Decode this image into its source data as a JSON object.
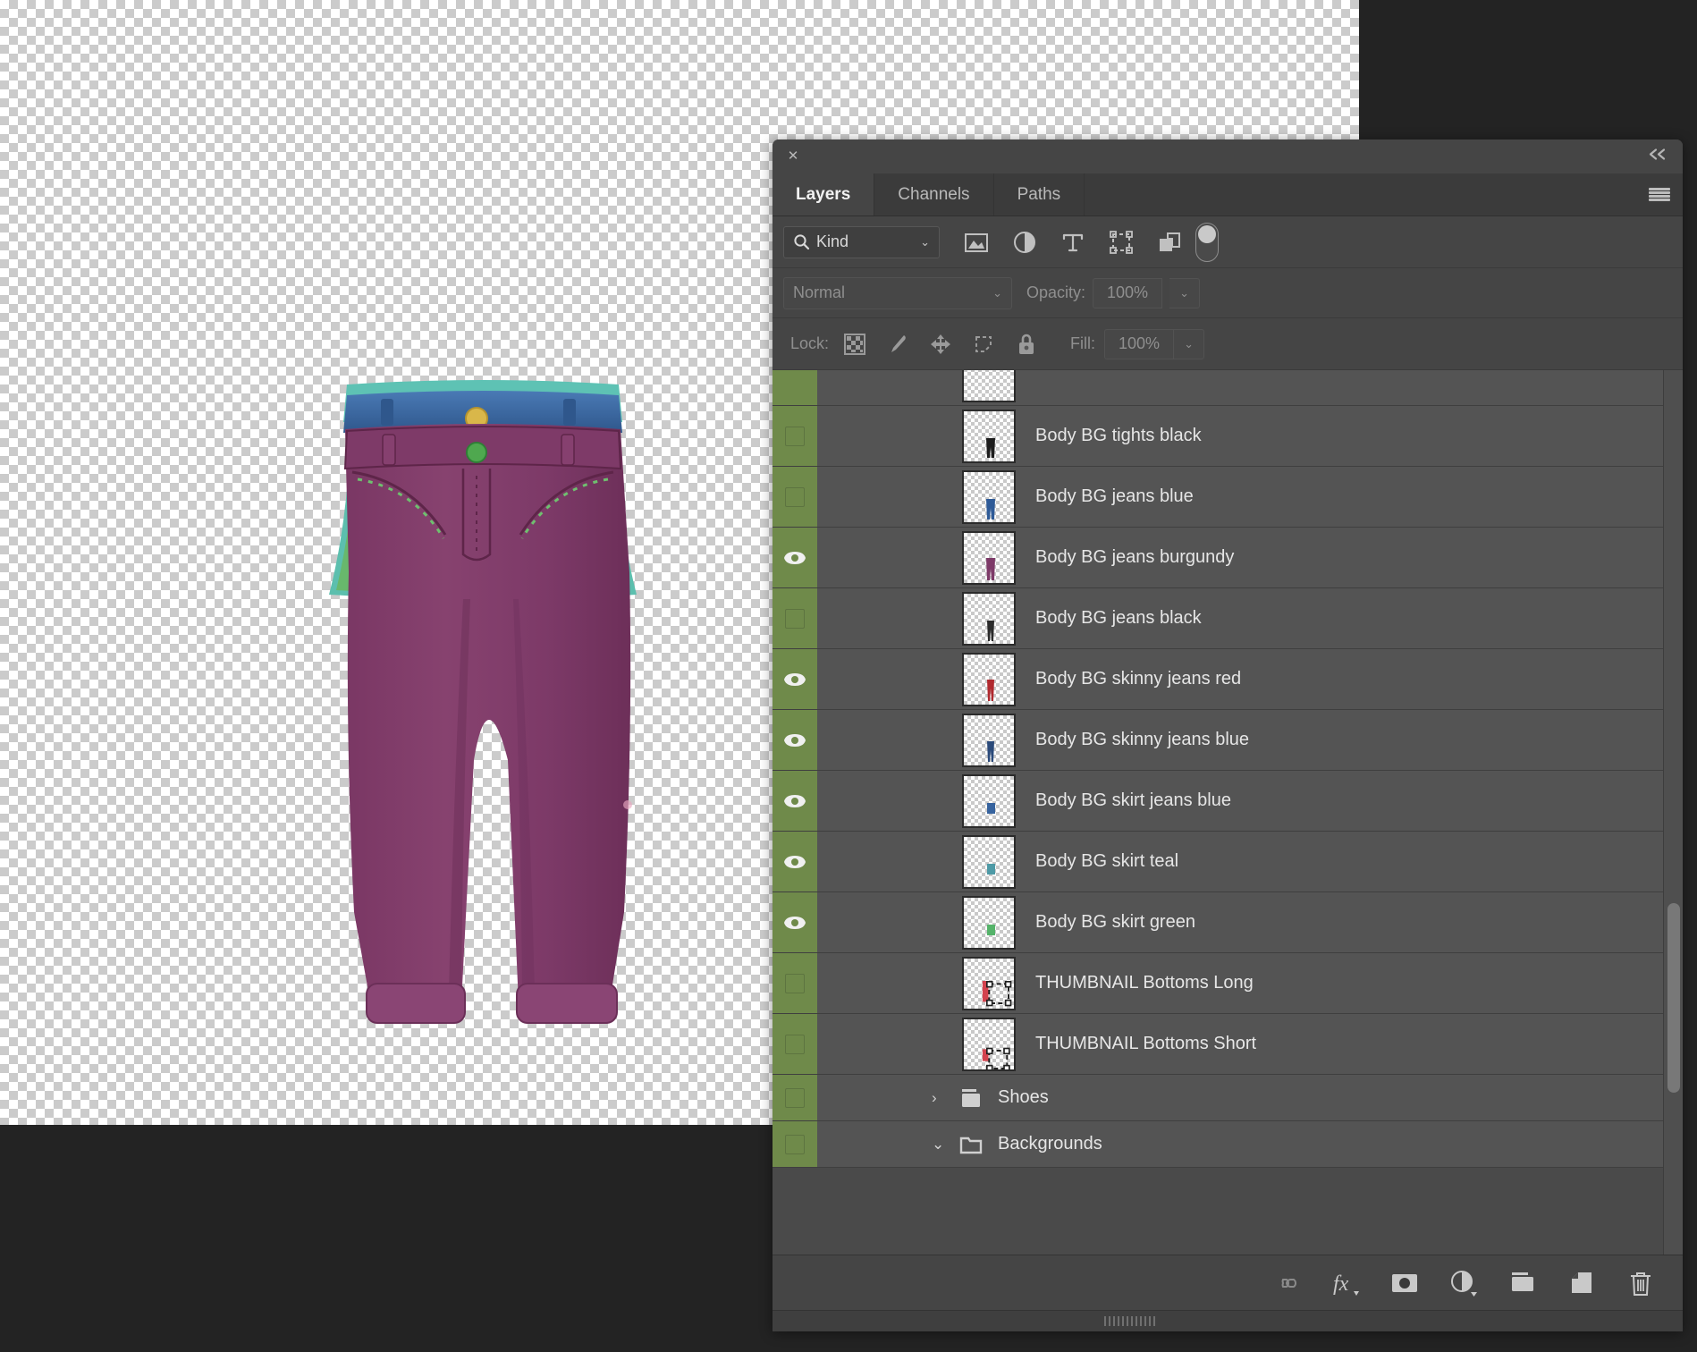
{
  "app": {
    "canvas_label": "transparent-canvas",
    "workspace_bg": "#232323"
  },
  "panel": {
    "close_label": "✕",
    "collapse_label": "«",
    "menu_label": "panel-menu",
    "tabs": [
      {
        "label": "Layers",
        "active": true
      },
      {
        "label": "Channels",
        "active": false
      },
      {
        "label": "Paths",
        "active": false
      }
    ],
    "filter": {
      "kind_label": "Kind",
      "chevron": "⌄",
      "icons": [
        "pixel-layer-filter",
        "adjustment-layer-filter",
        "type-layer-filter",
        "shape-layer-filter",
        "smart-object-filter"
      ],
      "toggle_name": "filter-enable-toggle"
    },
    "blend": {
      "mode": "Normal",
      "chevron": "⌄",
      "opacity_label": "Opacity:",
      "opacity_value": "100%",
      "stepper": "⌄"
    },
    "lock": {
      "label": "Lock:",
      "icons": [
        "lock-transparent-pixels",
        "lock-image-pixels",
        "lock-position",
        "lock-artboard-nesting",
        "lock-all"
      ],
      "fill_label": "Fill:",
      "fill_value": "100%",
      "stepper": "⌄"
    },
    "layers": [
      {
        "name": "",
        "visible": false,
        "color": "#6f8a4a",
        "thumb": "partial",
        "partial": true
      },
      {
        "name": "Body BG tights black",
        "visible": false,
        "color": "#6f8a4a",
        "thumb": "tights-black"
      },
      {
        "name": "Body BG jeans blue",
        "visible": false,
        "color": "#6f8a4a",
        "thumb": "jeans-blue"
      },
      {
        "name": "Body BG jeans burgundy",
        "visible": true,
        "color": "#6f8a4a",
        "thumb": "jeans-burgundy"
      },
      {
        "name": "Body BG jeans black",
        "visible": false,
        "color": "#6f8a4a",
        "thumb": "jeans-black"
      },
      {
        "name": "Body BG skinny jeans red",
        "visible": true,
        "color": "#6f8a4a",
        "thumb": "skinny-red"
      },
      {
        "name": "Body BG skinny jeans blue",
        "visible": true,
        "color": "#6f8a4a",
        "thumb": "skinny-blue"
      },
      {
        "name": "Body BG skirt jeans blue",
        "visible": true,
        "color": "#6f8a4a",
        "thumb": "skirt-blue"
      },
      {
        "name": "Body BG skirt teal",
        "visible": true,
        "color": "#6f8a4a",
        "thumb": "skirt-teal"
      },
      {
        "name": "Body BG skirt green",
        "visible": true,
        "color": "#6f8a4a",
        "thumb": "skirt-green"
      },
      {
        "name": "THUMBNAIL Bottoms Long",
        "visible": false,
        "color": "#6f8a4a",
        "thumb": "thumbnail-long"
      },
      {
        "name": "THUMBNAIL Bottoms Short",
        "visible": false,
        "color": "#6f8a4a",
        "thumb": "thumbnail-short"
      }
    ],
    "groups": [
      {
        "name": "Shoes",
        "expanded": false,
        "arrow": "›",
        "visible": false,
        "color": "#6f8a4a"
      },
      {
        "name": "Backgrounds",
        "expanded": true,
        "arrow": "⌄",
        "visible": false,
        "color": "#6f8a4a"
      }
    ],
    "footer_buttons": [
      "link-layers-icon",
      "layer-style-fx-icon",
      "layer-mask-icon",
      "adjustment-layer-icon",
      "new-group-icon",
      "new-layer-icon",
      "delete-layer-icon"
    ],
    "scrollbar": {
      "name": "layers-vertical-scrollbar"
    }
  },
  "artwork": {
    "name": "burgundy-jeans-illustration",
    "jeans_color": "#7d3a68",
    "jeans_shadow": "#6b2f58",
    "waistband_color": "#3d6aa3",
    "skirt_teal": "#4fb5a6",
    "skirt_green": "#66b56a",
    "skirt_blue": "#3f6fae",
    "button_gold": "#d9b74a",
    "button_green": "#4fa84f"
  }
}
